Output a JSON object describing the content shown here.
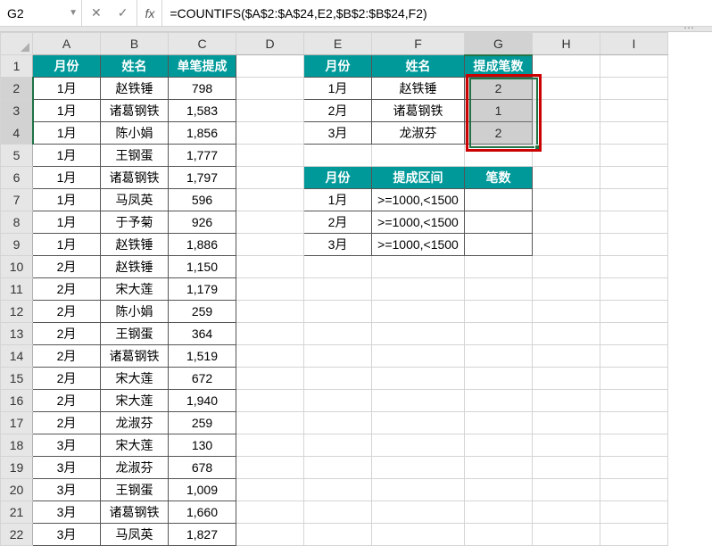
{
  "nameBox": "G2",
  "formula": "=COUNTIFS($A$2:$A$24,E2,$B$2:$B$24,F2)",
  "fxLabel": "fx",
  "columns": [
    "A",
    "B",
    "C",
    "D",
    "E",
    "F",
    "G",
    "H",
    "I"
  ],
  "rowCount": 22,
  "table1": {
    "headers": [
      "月份",
      "姓名",
      "单笔提成"
    ],
    "rows": [
      [
        "1月",
        "赵铁锤",
        "798"
      ],
      [
        "1月",
        "诸葛钢铁",
        "1,583"
      ],
      [
        "1月",
        "陈小娟",
        "1,856"
      ],
      [
        "1月",
        "王钢蛋",
        "1,777"
      ],
      [
        "1月",
        "诸葛钢铁",
        "1,797"
      ],
      [
        "1月",
        "马凤英",
        "596"
      ],
      [
        "1月",
        "于予菊",
        "926"
      ],
      [
        "1月",
        "赵铁锤",
        "1,886"
      ],
      [
        "2月",
        "赵铁锤",
        "1,150"
      ],
      [
        "2月",
        "宋大莲",
        "1,179"
      ],
      [
        "2月",
        "陈小娟",
        "259"
      ],
      [
        "2月",
        "王钢蛋",
        "364"
      ],
      [
        "2月",
        "诸葛钢铁",
        "1,519"
      ],
      [
        "2月",
        "宋大莲",
        "672"
      ],
      [
        "2月",
        "宋大莲",
        "1,940"
      ],
      [
        "2月",
        "龙淑芬",
        "259"
      ],
      [
        "3月",
        "宋大莲",
        "130"
      ],
      [
        "3月",
        "龙淑芬",
        "678"
      ],
      [
        "3月",
        "王钢蛋",
        "1,009"
      ],
      [
        "3月",
        "诸葛钢铁",
        "1,660"
      ],
      [
        "3月",
        "马凤英",
        "1,827"
      ]
    ]
  },
  "table2": {
    "headers": [
      "月份",
      "姓名",
      "提成笔数"
    ],
    "rows": [
      [
        "1月",
        "赵铁锤",
        "2"
      ],
      [
        "2月",
        "诸葛钢铁",
        "1"
      ],
      [
        "3月",
        "龙淑芬",
        "2"
      ]
    ]
  },
  "table3": {
    "headers": [
      "月份",
      "提成区间",
      "笔数"
    ],
    "rows": [
      [
        "1月",
        ">=1000,<1500",
        ""
      ],
      [
        "2月",
        ">=1000,<1500",
        ""
      ],
      [
        "3月",
        ">=1000,<1500",
        ""
      ]
    ]
  },
  "chart_data": {
    "type": "table",
    "title": "COUNTIFS Commission Count",
    "series": [
      {
        "name": "1月 赵铁锤",
        "values": [
          2
        ]
      },
      {
        "name": "2月 诸葛钢铁",
        "values": [
          1
        ]
      },
      {
        "name": "3月 龙淑芬",
        "values": [
          2
        ]
      }
    ]
  }
}
